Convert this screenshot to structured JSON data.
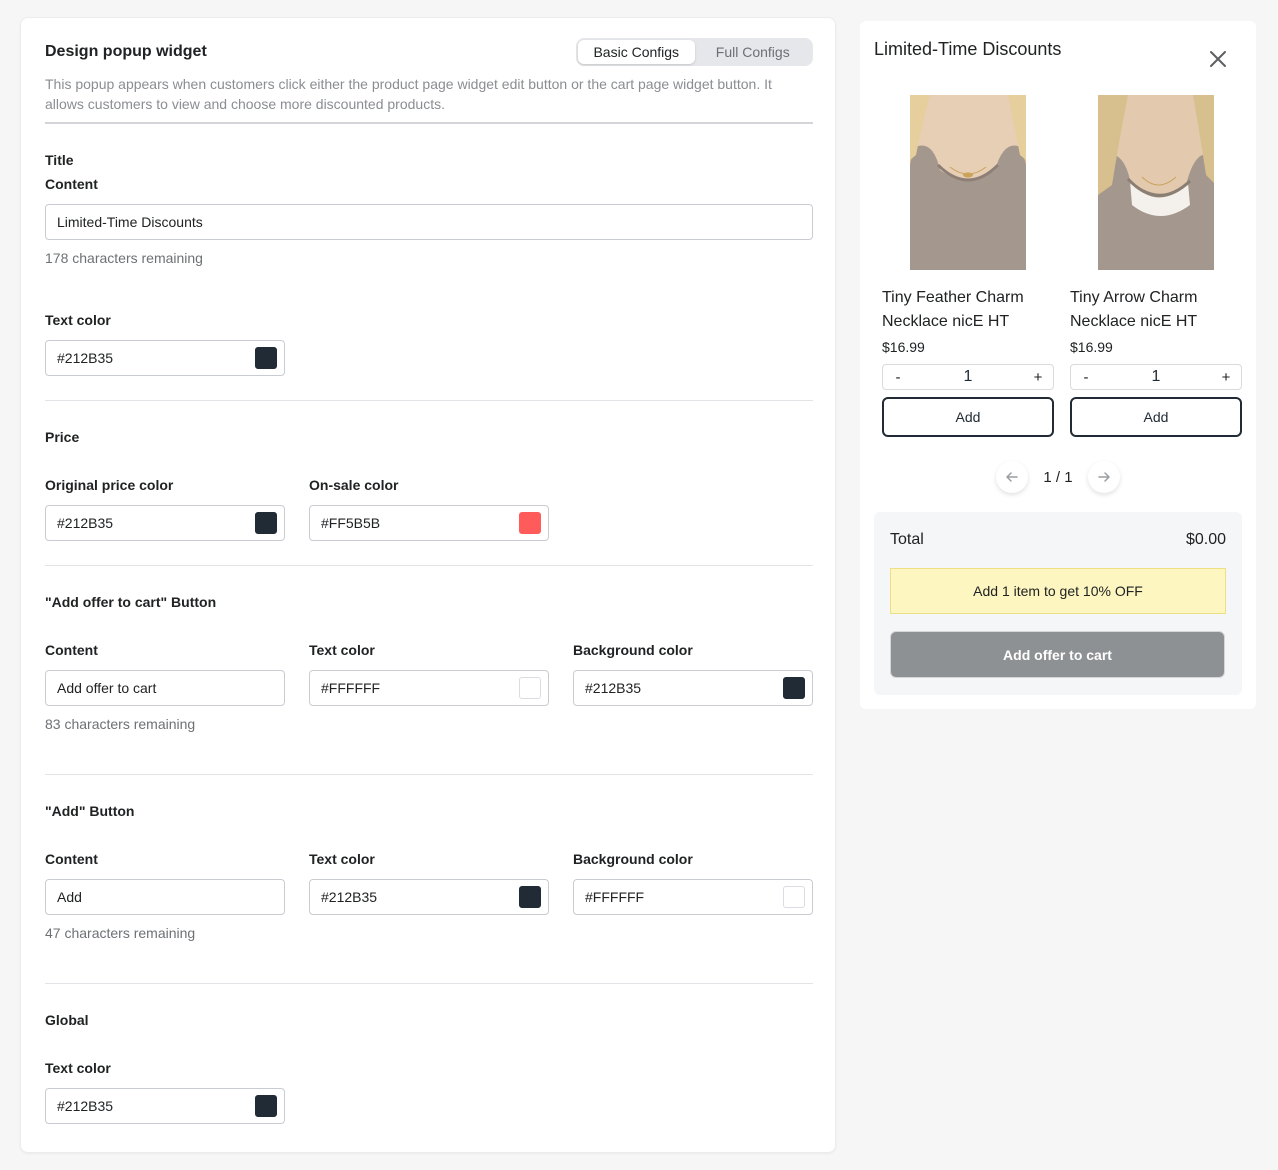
{
  "settings": {
    "title": "Design popup widget",
    "tabs": {
      "basic": "Basic Configs",
      "full": "Full Configs",
      "active": "basic"
    },
    "description": "This popup appears when customers click either the product page widget edit button or the cart page widget button. It allows customers to view and choose more discounted products.",
    "title_section": {
      "heading": "Title",
      "content_label": "Content",
      "content_value": "Limited-Time Discounts",
      "remaining": "178 characters remaining",
      "text_color_label": "Text color",
      "text_color": "#212B35"
    },
    "price_section": {
      "heading": "Price",
      "original_label": "Original price color",
      "original_color": "#212B35",
      "sale_label": "On-sale color",
      "sale_color": "#FF5B5B"
    },
    "offer_button_section": {
      "heading": "\"Add offer to cart\" Button",
      "content_label": "Content",
      "content_value": "Add offer to cart",
      "remaining": "83 characters remaining",
      "text_color_label": "Text color",
      "text_color": "#FFFFFF",
      "bg_color_label": "Background color",
      "bg_color": "#212B35"
    },
    "add_button_section": {
      "heading": "\"Add\" Button",
      "content_label": "Content",
      "content_value": "Add",
      "remaining": "47 characters remaining",
      "text_color_label": "Text color",
      "text_color": "#212B35",
      "bg_color_label": "Background color",
      "bg_color": "#FFFFFF"
    },
    "global_section": {
      "heading": "Global",
      "text_color_label": "Text color",
      "text_color": "#212B35"
    }
  },
  "preview": {
    "title": "Limited-Time Discounts",
    "close_icon": "close-icon",
    "products": [
      {
        "name": "Tiny Feather Charm Necklace nicE HT",
        "price": "$16.99",
        "quantity": "1",
        "minus": "-",
        "plus": "+",
        "add_label": "Add"
      },
      {
        "name": "Tiny Arrow Charm Necklace nicE HT",
        "price": "$16.99",
        "quantity": "1",
        "minus": "-",
        "plus": "+",
        "add_label": "Add"
      }
    ],
    "pagination": {
      "label": "1 / 1",
      "prev_icon": "arrow-left-icon",
      "next_icon": "arrow-right-icon"
    },
    "total_label": "Total",
    "total_value": "$0.00",
    "banner": "Add 1 item to get 10% OFF",
    "offer_button": "Add offer to cart"
  },
  "colors": {
    "page_bg": "#F6F6F7",
    "offer_button_preview_bg": "#8E9194",
    "banner_bg": "#FDF6C0"
  }
}
